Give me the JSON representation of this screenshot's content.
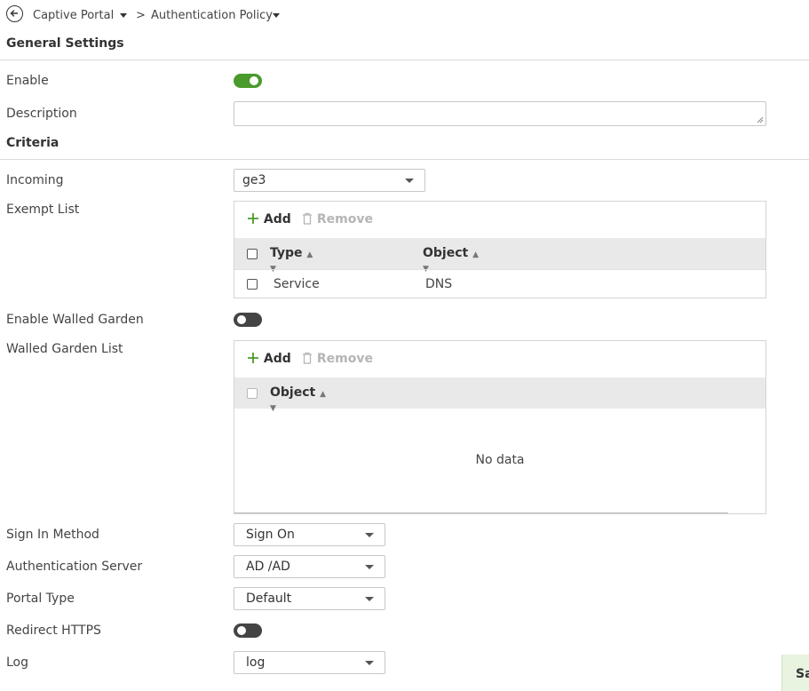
{
  "breadcrumb": {
    "parent": "Captive Portal",
    "separator": ">",
    "current": "Authentication Policy"
  },
  "general": {
    "title": "General Settings",
    "enable_label": "Enable",
    "enable_on": true,
    "description_label": "Description",
    "description_value": ""
  },
  "criteria": {
    "title": "Criteria",
    "incoming_label": "Incoming",
    "incoming_value": "ge3",
    "exempt_label": "Exempt List",
    "exempt": {
      "add_label": "Add",
      "remove_label": "Remove",
      "columns": [
        "Type",
        "Object"
      ],
      "rows": [
        {
          "type": "Service",
          "object": "DNS"
        }
      ]
    },
    "walled_garden_label": "Enable Walled Garden",
    "walled_garden_on": false,
    "walled_list_label": "Walled Garden List",
    "walled": {
      "add_label": "Add",
      "remove_label": "Remove",
      "column": "Object",
      "empty_text": "No data"
    },
    "signin_label": "Sign In Method",
    "signin_value": "Sign On",
    "authserver_label": "Authentication Server",
    "authserver_value": "AD /AD",
    "portaltype_label": "Portal Type",
    "portaltype_value": "Default",
    "redirect_label": "Redirect HTTPS",
    "redirect_on": false,
    "log_label": "Log",
    "log_value": "log"
  },
  "footer": {
    "save_partial": "Sa"
  },
  "colors": {
    "toggle_on": "#4a9a2c",
    "toggle_off": "#444444",
    "add_icon": "#4a9a2c",
    "save_bg": "#e8f3e0"
  }
}
